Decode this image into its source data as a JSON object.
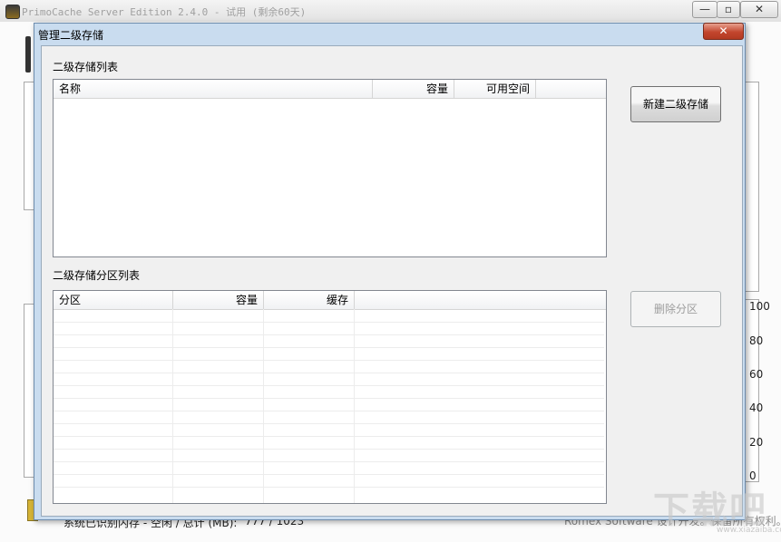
{
  "main_window": {
    "title": "PrimoCache Server Edition 2.4.0 - 试用 (剩余60天)",
    "min_glyph": "—",
    "max_glyph": "▫",
    "close_glyph": "✕",
    "axis_labels": [
      "100",
      "80",
      "60",
      "40",
      "20",
      "0"
    ],
    "status_label": "系统已识别内存 - 空闲 / 总计 (MB):",
    "status_value": "777 / 1023",
    "credit": "Romex Software 设计开发。保留所有权利。"
  },
  "dialog": {
    "title": "管理二级存储",
    "close_glyph": "✕",
    "storage_list": {
      "label": "二级存储列表",
      "columns": [
        "名称",
        "容量",
        "可用空间"
      ],
      "rows": []
    },
    "partition_list": {
      "label": "二级存储分区列表",
      "columns": [
        "分区",
        "容量",
        "缓存"
      ],
      "rows": []
    },
    "new_button": "新建二级存储",
    "delete_button": "删除分区"
  },
  "watermark": {
    "text": "下载吧",
    "url": "www.xiazaiba.com"
  },
  "icons": [
    "app-icon",
    "memory-icon"
  ]
}
